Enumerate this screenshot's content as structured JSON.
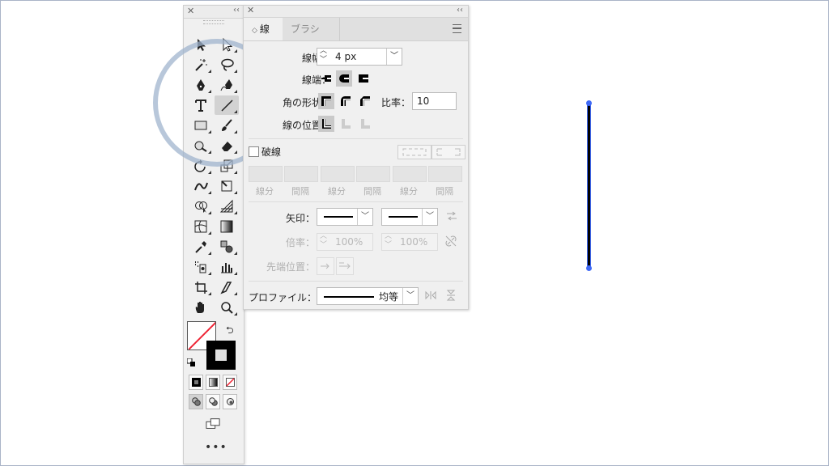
{
  "toolbox": {
    "tools": [
      {
        "name": "selection",
        "icon": "selection-arrow-icon",
        "selected": false
      },
      {
        "name": "direct-selection",
        "icon": "direct-selection-icon",
        "selected": false
      },
      {
        "name": "magic-wand",
        "icon": "magic-wand-icon",
        "selected": false
      },
      {
        "name": "lasso",
        "icon": "lasso-icon",
        "selected": false
      },
      {
        "name": "pen",
        "icon": "pen-icon",
        "selected": false
      },
      {
        "name": "curvature",
        "icon": "curvature-pen-icon",
        "selected": false
      },
      {
        "name": "type",
        "icon": "type-icon",
        "selected": false
      },
      {
        "name": "line-segment",
        "icon": "line-segment-icon",
        "selected": true
      },
      {
        "name": "rectangle",
        "icon": "rectangle-icon",
        "selected": false
      },
      {
        "name": "paintbrush",
        "icon": "paintbrush-icon",
        "selected": false
      },
      {
        "name": "shaper",
        "icon": "shaper-icon",
        "selected": false
      },
      {
        "name": "eraser",
        "icon": "eraser-icon",
        "selected": false
      },
      {
        "name": "rotate",
        "icon": "rotate-icon",
        "selected": false
      },
      {
        "name": "scale",
        "icon": "scale-icon",
        "selected": false
      },
      {
        "name": "width",
        "icon": "width-icon",
        "selected": false
      },
      {
        "name": "free-transform",
        "icon": "free-transform-icon",
        "selected": false
      },
      {
        "name": "shape-builder",
        "icon": "shape-builder-icon",
        "selected": false
      },
      {
        "name": "perspective-grid",
        "icon": "perspective-grid-icon",
        "selected": false
      },
      {
        "name": "mesh",
        "icon": "mesh-icon",
        "selected": false
      },
      {
        "name": "gradient",
        "icon": "gradient-icon",
        "selected": false
      },
      {
        "name": "eyedropper",
        "icon": "eyedropper-icon",
        "selected": false
      },
      {
        "name": "blend",
        "icon": "blend-icon",
        "selected": false
      },
      {
        "name": "symbol-sprayer",
        "icon": "symbol-sprayer-icon",
        "selected": false
      },
      {
        "name": "column-graph",
        "icon": "column-graph-icon",
        "selected": false
      },
      {
        "name": "artboard",
        "icon": "artboard-icon",
        "selected": false
      },
      {
        "name": "slice",
        "icon": "slice-icon",
        "selected": false
      },
      {
        "name": "hand",
        "icon": "hand-icon",
        "selected": false
      },
      {
        "name": "zoom",
        "icon": "zoom-icon",
        "selected": false
      }
    ],
    "more_label": "•••"
  },
  "stroke_panel": {
    "tabs": [
      {
        "label": "線",
        "active": true
      },
      {
        "label": "ブラシ",
        "active": false
      }
    ],
    "weight_label": "線幅：",
    "weight_value": "4 px",
    "cap_label": "線端：",
    "corner_label": "角の形状：",
    "limit_label": "比率：",
    "limit_value": "10",
    "align_label": "線の位置：",
    "dashed_label": "破線",
    "dash_labels": [
      "線分",
      "間隔",
      "線分",
      "間隔",
      "線分",
      "間隔"
    ],
    "arrow_label": "矢印：",
    "scale_label": "倍率：",
    "scale_start": "100%",
    "scale_end": "100%",
    "align_arrow_label": "先端位置：",
    "profile_label": "プロファイル：",
    "profile_value": "均等"
  },
  "colors": {
    "selection_blue": "#3f69f5",
    "highlight_circle": "#a0b4cd"
  }
}
